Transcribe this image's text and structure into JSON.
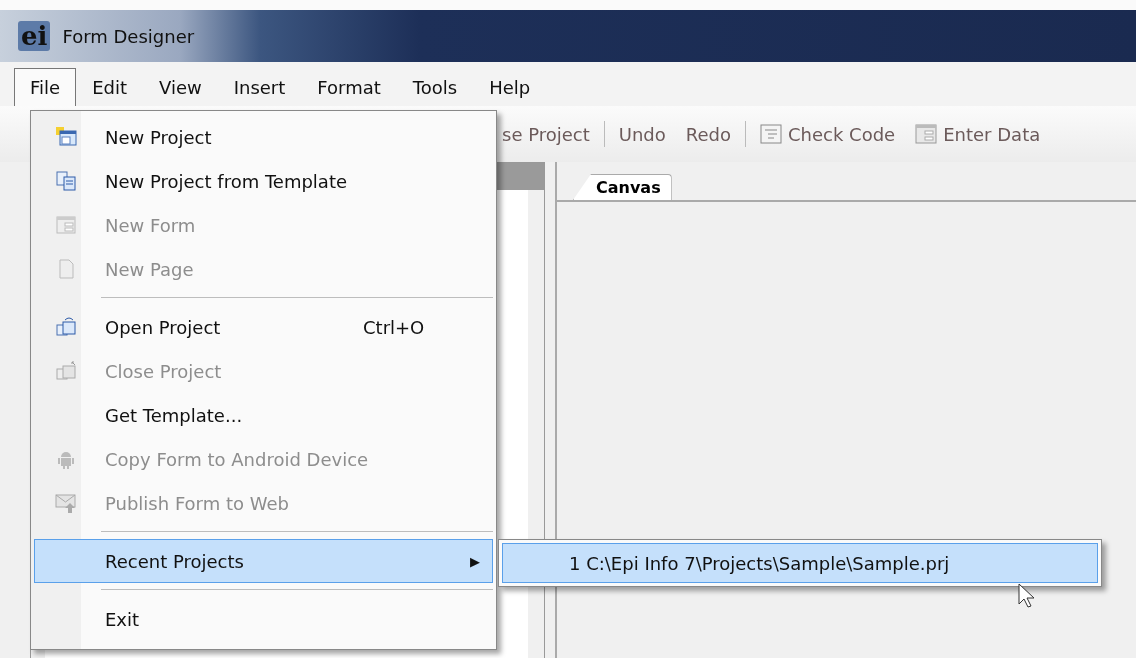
{
  "window": {
    "title": "Form Designer",
    "logo_text": "ei"
  },
  "menu_bar": [
    {
      "label": "File",
      "selected": true
    },
    {
      "label": "Edit",
      "selected": false
    },
    {
      "label": "View",
      "selected": false
    },
    {
      "label": "Insert",
      "selected": false
    },
    {
      "label": "Format",
      "selected": false
    },
    {
      "label": "Tools",
      "selected": false
    },
    {
      "label": "Help",
      "selected": false
    }
  ],
  "toolbar_groups": [
    [
      {
        "kind": "text",
        "label": "se Project"
      }
    ],
    [
      {
        "kind": "text",
        "label": "Undo"
      },
      {
        "kind": "text",
        "label": "Redo"
      }
    ],
    [
      {
        "kind": "icon",
        "label": "Check Code"
      },
      {
        "kind": "icon",
        "label": "Enter Data"
      }
    ]
  ],
  "canvas_tab": {
    "label": "Canvas",
    "selected": true
  },
  "file_menu": [
    {
      "kind": "item",
      "label": "New Project",
      "disabled": false
    },
    {
      "kind": "item",
      "label": "New Project from Template",
      "disabled": false
    },
    {
      "kind": "item",
      "label": "New Form",
      "disabled": true
    },
    {
      "kind": "item",
      "label": "New Page",
      "disabled": true
    },
    {
      "kind": "separator"
    },
    {
      "kind": "item",
      "label": "Open Project",
      "shortcut": "Ctrl+O",
      "disabled": false
    },
    {
      "kind": "item",
      "label": "Close Project",
      "disabled": true
    },
    {
      "kind": "item",
      "label": "Get Template...",
      "disabled": false
    },
    {
      "kind": "item",
      "label": "Copy Form to Android Device",
      "disabled": true
    },
    {
      "kind": "item",
      "label": "Publish Form to Web",
      "disabled": true
    },
    {
      "kind": "separator"
    },
    {
      "kind": "submenu",
      "label": "Recent Projects",
      "selected": true,
      "submenu_arrow": "▶"
    },
    {
      "kind": "separator"
    },
    {
      "kind": "item",
      "label": "Exit",
      "disabled": false
    }
  ],
  "recent_projects_submenu": [
    {
      "label": "1 C:\\Epi Info 7\\Projects\\Sample\\Sample.prj",
      "selected": true
    }
  ]
}
